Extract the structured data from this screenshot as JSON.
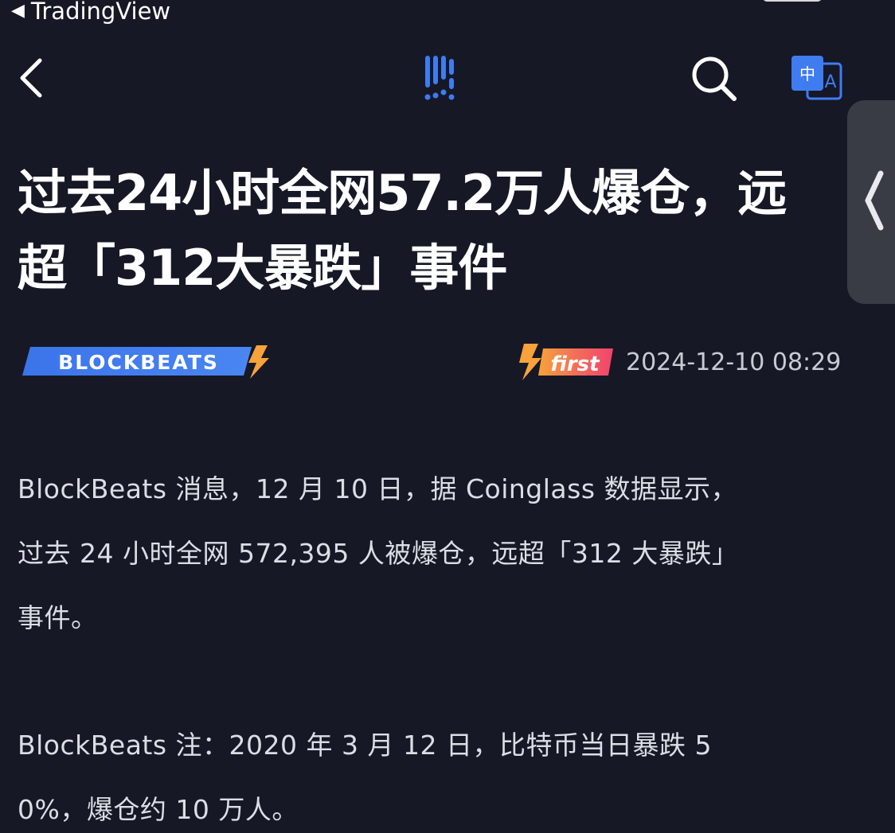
{
  "status_bar": {
    "back_app": "TradingView"
  },
  "header": {
    "back_icon": "chevron-left-icon",
    "logo_icon": "blockbeats-logo-icon",
    "search_icon": "search-icon",
    "translate_icon": "translate-icon",
    "translate_glyph_zh": "中",
    "translate_glyph_en": "A"
  },
  "article": {
    "title_line1": "过去24小时全网57.2万人爆仓，远",
    "title_line2": "超「312大暴跌」事件",
    "source": "BLOCKBEATS",
    "badge": "first",
    "datetime": "2024-12-10 08:29",
    "paragraph1_lines": [
      "BlockBeats 消息，12 月 10 日，据 Coinglass 数据显示，",
      "过去 24 小时全网 572,395 人被爆仓，远超「312 大暴跌」",
      "事件。"
    ],
    "paragraph2_lines": [
      "BlockBeats 注：2020 年 3 月 12 日，比特币当日暴跌 5",
      "0%，爆仓约 10 万人。"
    ]
  },
  "colors": {
    "background": "#161826",
    "brand_blue": "#3f7cf0",
    "accent_orange": "#f7a23a",
    "badge_pink": "#f2436e"
  }
}
